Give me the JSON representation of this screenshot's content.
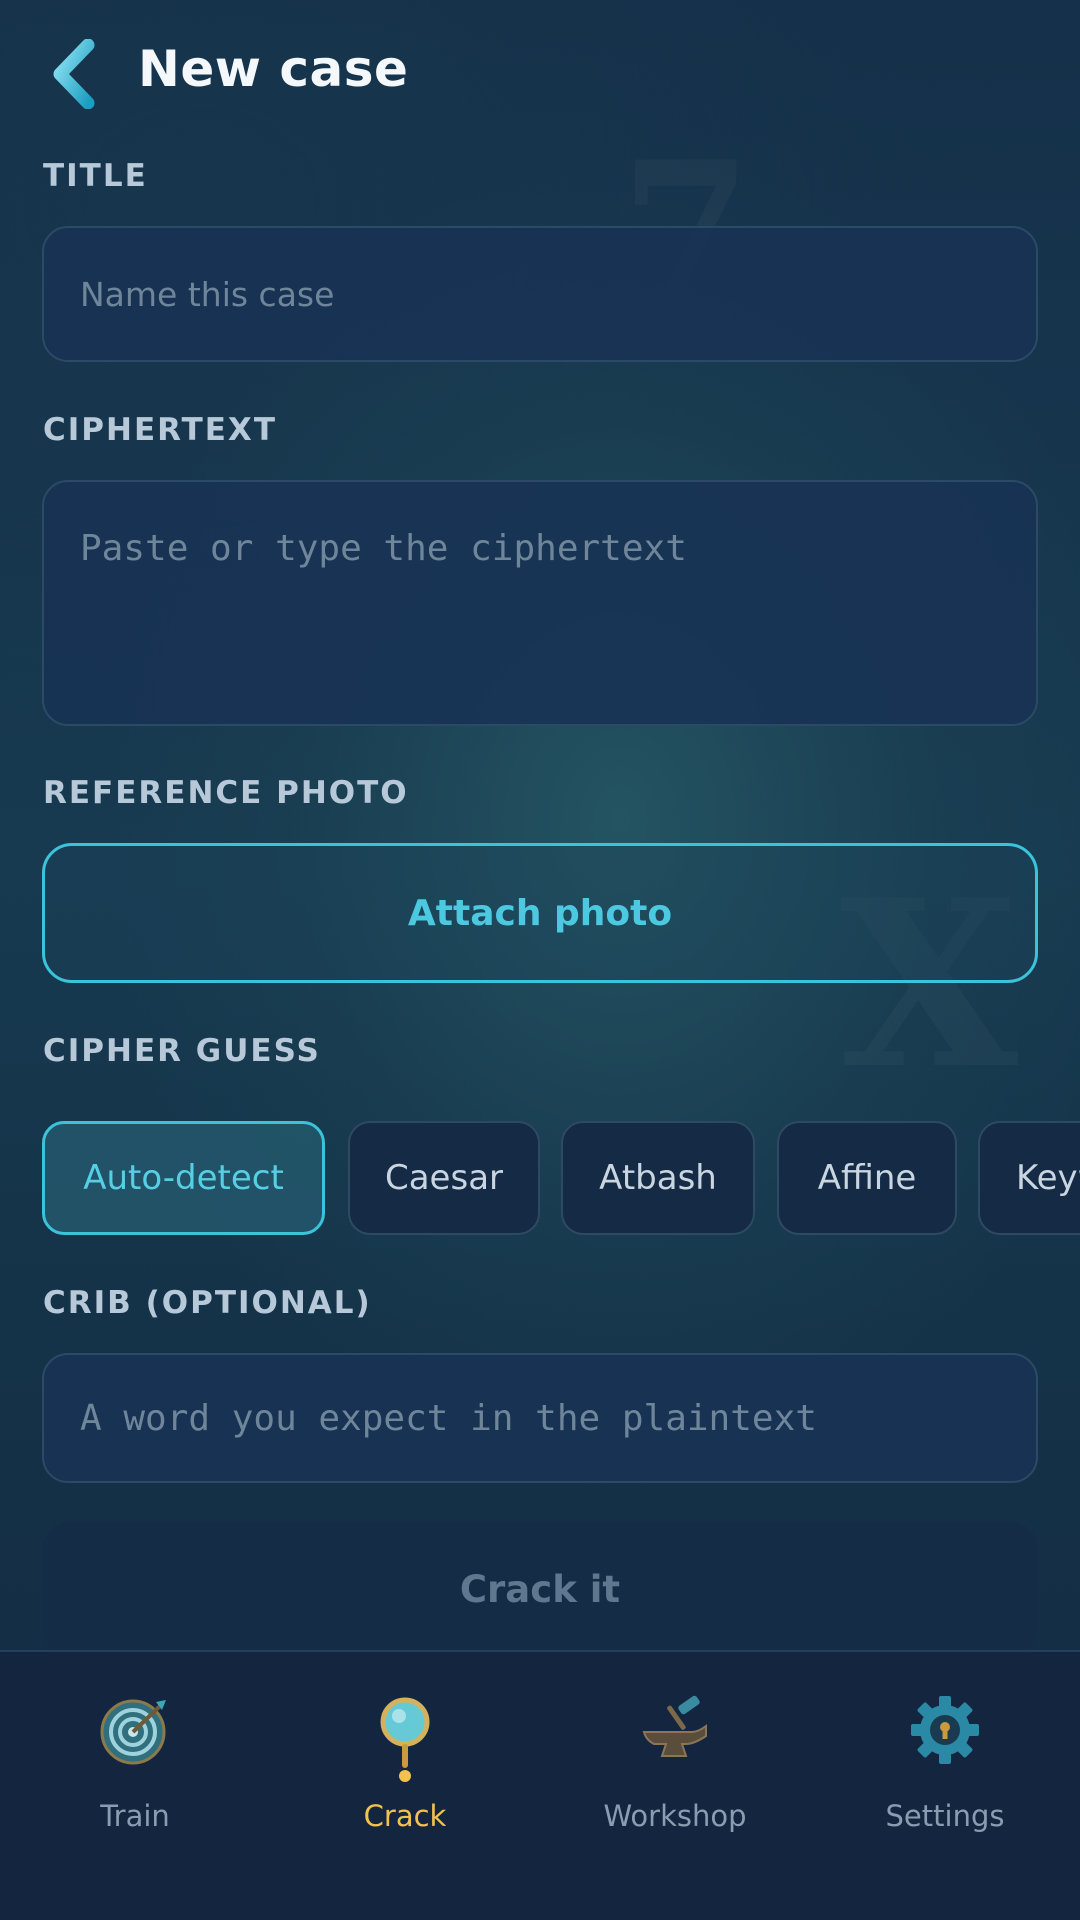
{
  "header": {
    "title": "New case"
  },
  "sections": {
    "title_label": "TITLE",
    "ciphertext_label": "CIPHERTEXT",
    "photo_label": "REFERENCE PHOTO",
    "guess_label": "CIPHER GUESS",
    "crib_label": "CRIB (OPTIONAL)"
  },
  "fields": {
    "title": {
      "value": "",
      "placeholder": "Name this case"
    },
    "ciphertext": {
      "value": "",
      "placeholder": "Paste or type the ciphertext"
    },
    "crib": {
      "value": "",
      "placeholder": "A word you expect in the plaintext"
    }
  },
  "attach_label": "Attach photo",
  "cipher_options": [
    "Auto-detect",
    "Caesar",
    "Atbash",
    "Affine",
    "Keyword"
  ],
  "selected_cipher": "Auto-detect",
  "crack_label": "Crack it",
  "tabs": [
    {
      "label": "Train",
      "icon": "target-icon"
    },
    {
      "label": "Crack",
      "icon": "magnifier-icon",
      "active": true
    },
    {
      "label": "Workshop",
      "icon": "anvil-icon"
    },
    {
      "label": "Settings",
      "icon": "gear-icon"
    }
  ],
  "colors": {
    "accent": "#3bc3da",
    "active_tab": "#f2c24d",
    "background": "#15304a"
  }
}
